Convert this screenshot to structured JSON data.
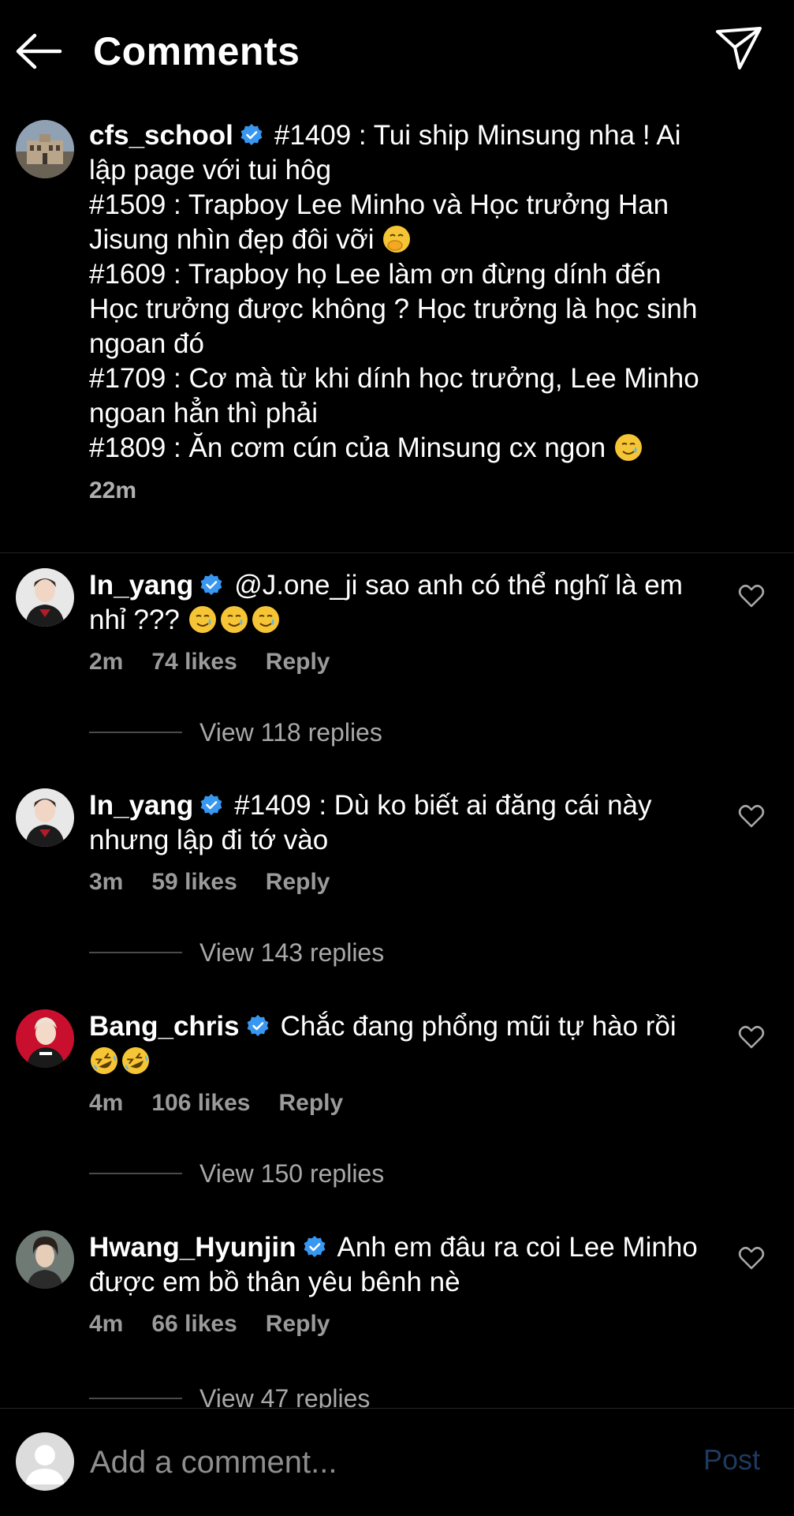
{
  "header": {
    "title": "Comments"
  },
  "caption": {
    "username": "cfs_school",
    "lines": [
      "#1409 : Tui ship Minsung nha ! Ai",
      "lập page với tui hôg",
      "#1509 : Trapboy Lee Minho và Học trưởng Han",
      "Jisung nhìn đẹp đôi vỡi",
      "#1609 : Trapboy họ Lee làm ơn đừng dính đến",
      "Học trưởng được không ? Học trưởng là học sinh",
      "ngoan đó",
      "#1709 : Cơ mà từ khi dính học trưởng, Lee Minho",
      "ngoan hẳn thì phải",
      "#1809 : Ăn cơm cún của Minsung cx ngon"
    ],
    "time": "22m"
  },
  "comments": [
    {
      "username": "In_yang",
      "line1": "@J.one_ji sao anh có thể nghĩ là em",
      "line2": "nhỉ ???",
      "time": "2m",
      "likes": "74 likes",
      "reply": "Reply",
      "view_replies": "View 118 replies"
    },
    {
      "username": "In_yang",
      "line1": "#1409 : Dù ko biết ai đăng cái này",
      "line2": "nhưng lập đi tớ vào",
      "time": "3m",
      "likes": "59 likes",
      "reply": "Reply",
      "view_replies": "View 143 replies"
    },
    {
      "username": "Bang_chris",
      "line1": "Chắc đang phổng mũi tự hào rồi",
      "line2": "",
      "time": "4m",
      "likes": "106 likes",
      "reply": "Reply",
      "view_replies": "View 150 replies"
    },
    {
      "username": "Hwang_Hyunjin",
      "line1": "Anh em đâu ra coi Lee Minho",
      "line2": "được em bồ thân yêu bênh nè",
      "time": "4m",
      "likes": "66 likes",
      "reply": "Reply",
      "view_replies": "View 47 replies"
    }
  ],
  "composer": {
    "placeholder": "Add a comment...",
    "post_label": "Post"
  },
  "colors": {
    "verified": "#3897f0",
    "post_disabled": "#1f3a5f",
    "muted": "#9a9a9a"
  },
  "icons": [
    "back-arrow-icon",
    "send-icon",
    "verified-icon",
    "heart-icon",
    "smiling-face-tear-icon",
    "face-hand-over-mouth-icon",
    "rolling-laughing-icon"
  ]
}
